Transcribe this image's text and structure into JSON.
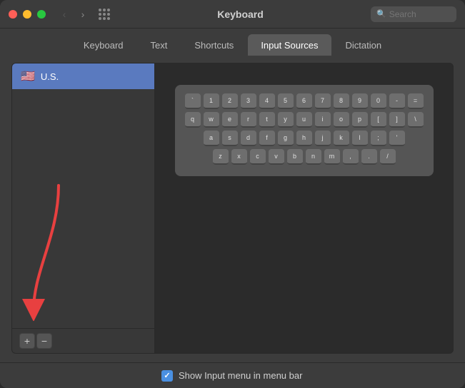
{
  "window": {
    "title": "Keyboard"
  },
  "titleBar": {
    "close": "close",
    "minimize": "minimize",
    "maximize": "maximize",
    "backBtn": "‹",
    "forwardBtn": "›",
    "searchPlaceholder": "Search"
  },
  "tabs": [
    {
      "id": "keyboard",
      "label": "Keyboard",
      "active": false
    },
    {
      "id": "text",
      "label": "Text",
      "active": false
    },
    {
      "id": "shortcuts",
      "label": "Shortcuts",
      "active": false
    },
    {
      "id": "input-sources",
      "label": "Input Sources",
      "active": true
    },
    {
      "id": "dictation",
      "label": "Dictation",
      "active": false
    }
  ],
  "sidebar": {
    "items": [
      {
        "flag": "🇺🇸",
        "label": "U.S."
      }
    ],
    "addBtn": "+",
    "removeBtn": "−"
  },
  "keyboard": {
    "rows": [
      [
        "`",
        "1",
        "2",
        "3",
        "4",
        "5",
        "6",
        "7",
        "8",
        "9",
        "0",
        "-",
        "="
      ],
      [
        "q",
        "w",
        "e",
        "r",
        "t",
        "y",
        "u",
        "i",
        "o",
        "p",
        "[",
        "]",
        "\\"
      ],
      [
        "a",
        "s",
        "d",
        "f",
        "g",
        "h",
        "j",
        "k",
        "l",
        ";",
        "'"
      ],
      [
        "z",
        "x",
        "c",
        "v",
        "b",
        "n",
        "m",
        ",",
        ".",
        "/"
      ]
    ]
  },
  "bottomBar": {
    "checkboxLabel": "Show Input menu in menu bar",
    "checked": true
  }
}
